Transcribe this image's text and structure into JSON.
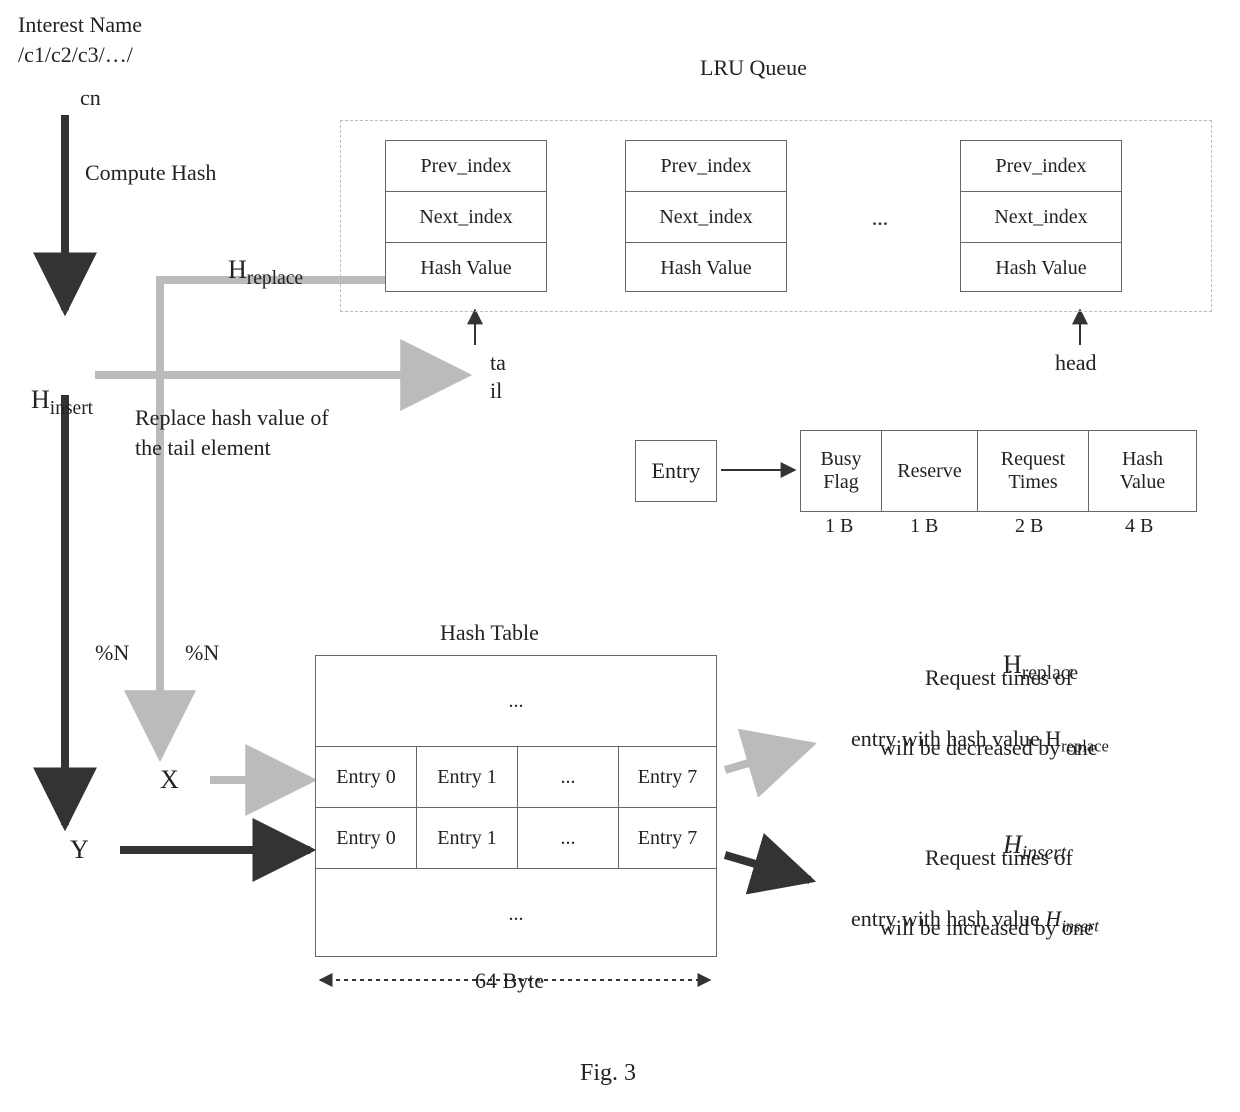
{
  "header": {
    "interest_name_label": "Interest Name",
    "interest_name_value": "/c1/c2/c3/…/",
    "interest_name_tail": "cn"
  },
  "labels": {
    "compute_hash": "Compute Hash",
    "h_insert": "H",
    "h_insert_sub": "insert",
    "h_replace": "H",
    "h_replace_sub": "replace",
    "replace_text_l1": "Replace hash value of",
    "replace_text_l2": "the tail element",
    "mod_n_a": "%N",
    "mod_n_b": "%N",
    "x": "X",
    "y": "Y",
    "lru_queue": "LRU Queue",
    "tail_l1": "ta",
    "tail_l2": "il",
    "head": "head",
    "hash_table": "Hash Table",
    "sixty_four_byte": "64 Byte",
    "fig": "Fig. 3"
  },
  "lru_node_fields": [
    "Prev_index",
    "Next_index",
    "Hash Value"
  ],
  "lru_ellipsis": "...",
  "entry_legend": {
    "label": "Entry",
    "cols": [
      "Busy\nFlag",
      "Reserve",
      "Request\nTimes",
      "Hash\nValue"
    ],
    "sizes": [
      "1 B",
      "1 B",
      "2 B",
      "4 B"
    ]
  },
  "hash_table": {
    "row_top": "...",
    "row_mid": [
      "Entry 0",
      "Entry 1",
      "...",
      "Entry 7"
    ],
    "row_bot": "..."
  },
  "right_notes": {
    "h_replace_title": "H",
    "h_replace_title_sub": "replace",
    "h_replace_l1": "Request times of",
    "h_replace_l2_a": "entry with hash value H",
    "h_replace_l2_sub": "replace",
    "h_replace_l3": "will be decreased by one",
    "h_insert_title": "H",
    "h_insert_title_sub": "insert",
    "h_insert_l1": "Request times of",
    "h_insert_l2_a": "entry with hash value ",
    "h_insert_l2_b": "H",
    "h_insert_l2_sub": "insert",
    "h_insert_l3": "will be increased by one"
  }
}
